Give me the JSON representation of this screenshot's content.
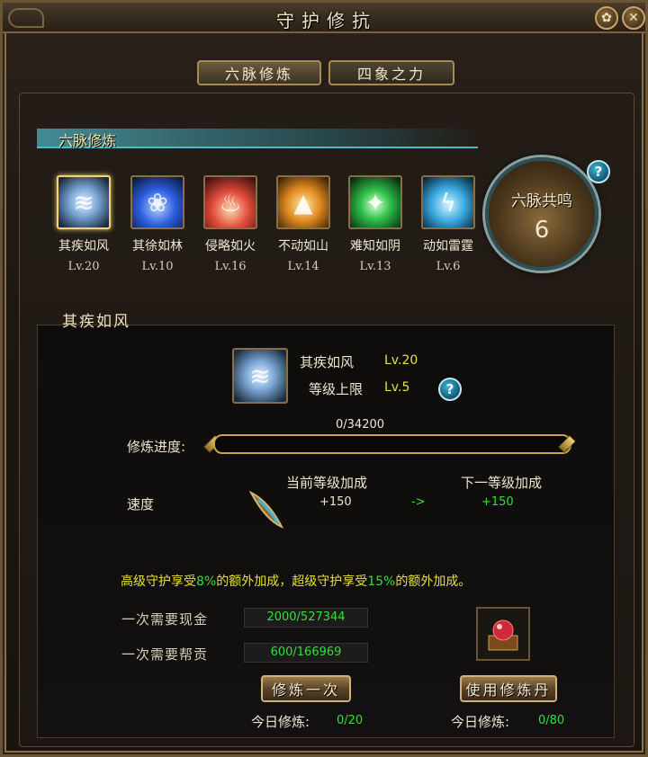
{
  "window": {
    "title": "守护修抗"
  },
  "tabs": [
    {
      "label": "六脉修炼",
      "active": true
    },
    {
      "label": "四象之力",
      "active": false
    }
  ],
  "section_title": "六脉修炼",
  "veins": [
    {
      "name": "其疾如风",
      "level": "Lv.20",
      "icon": "wind-icon",
      "selected": true
    },
    {
      "name": "其徐如林",
      "level": "Lv.10",
      "icon": "lotus-icon"
    },
    {
      "name": "侵略如火",
      "level": "Lv.16",
      "icon": "fire-icon"
    },
    {
      "name": "不动如山",
      "level": "Lv.14",
      "icon": "mountain-icon"
    },
    {
      "name": "难知如阴",
      "level": "Lv.13",
      "icon": "shadow-icon"
    },
    {
      "name": "动如雷霆",
      "level": "Lv.6",
      "icon": "thunder-icon"
    }
  ],
  "resonance": {
    "label": "六脉共鸣",
    "value": "6"
  },
  "detail": {
    "title": "其疾如风",
    "name": "其疾如风",
    "level": "Lv.20",
    "cap_label": "等级上限",
    "cap_level": "Lv.5",
    "progress_label": "修炼进度:",
    "progress_text": "0/34200",
    "progress_fraction": 0,
    "current_bonus_label": "当前等级加成",
    "next_bonus_label": "下一等级加成",
    "stat_label": "速度",
    "current_value": "+150",
    "arrow": "->",
    "next_value": "+150",
    "bonus_note": {
      "part1": "高级守护享受",
      "pct1": "8%",
      "part2": "的额外加成，超级守护享受",
      "pct2": "15%",
      "part3": "的额外加成。"
    },
    "cost_money_label": "一次需要现金",
    "cost_money_value": "2000/527344",
    "cost_guild_label": "一次需要帮贡",
    "cost_guild_value": "600/166969",
    "btn_train_once": "修炼一次",
    "btn_use_pill": "使用修炼丹",
    "daily_label": "今日修炼:",
    "daily_train": "0/20",
    "daily_pill": "0/80"
  },
  "colors": {
    "highlight_yellow": "#e5e236",
    "value_green": "#35e035",
    "frame_gold": "#c9a24a"
  }
}
